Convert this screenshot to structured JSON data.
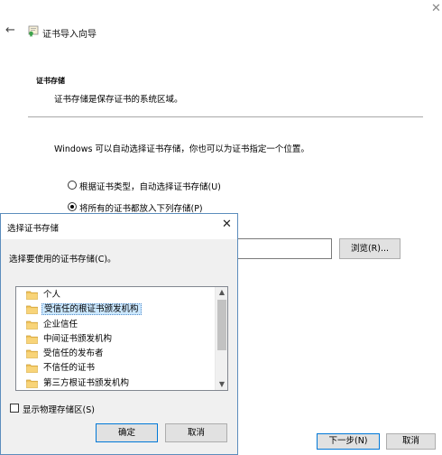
{
  "wizard": {
    "title": "证书导入向导",
    "section_title": "证书存储",
    "section_subtitle": "证书存储是保存证书的系统区域。",
    "description": "Windows 可以自动选择证书存储，你也可以为证书指定一个位置。",
    "radio_auto_label": "根据证书类型，自动选择证书存储(U)",
    "radio_all_label": "将所有的证书都放入下列存储(P)",
    "selected_radio": "all",
    "store_value": "",
    "browse_label": "浏览(R)...",
    "next_label": "下一步(N)",
    "cancel_label": "取消"
  },
  "dialog": {
    "title": "选择证书存储",
    "prompt": "选择要使用的证书存储(C)。",
    "stores": [
      {
        "label": "个人",
        "selected": false
      },
      {
        "label": "受信任的根证书颁发机构",
        "selected": true
      },
      {
        "label": "企业信任",
        "selected": false
      },
      {
        "label": "中间证书颁发机构",
        "selected": false
      },
      {
        "label": "受信任的发布者",
        "selected": false
      },
      {
        "label": "不信任的证书",
        "selected": false
      },
      {
        "label": "第三方根证书颁发机构",
        "selected": false
      }
    ],
    "show_physical_label": "显示物理存储区(S)",
    "show_physical_checked": false,
    "ok_label": "确定",
    "cancel_label": "取消"
  },
  "icons": {
    "back": "back-arrow-icon",
    "wizard_close": "close-icon",
    "certificate": "certificate-icon",
    "folder": "folder-icon"
  },
  "colors": {
    "accent_border": "#0078d7",
    "selection_bg": "#cce8ff",
    "folder_yellow": "#f2c45c",
    "dialog_bg": "#f0f0f0"
  }
}
